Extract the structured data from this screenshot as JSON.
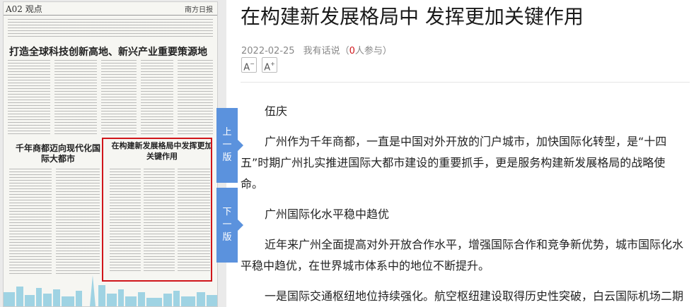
{
  "newspaper": {
    "page_number": "A02",
    "section": "观点",
    "masthead": "南方日报",
    "headline": "打造全球科技创新高地、新兴产业重要策源地",
    "sub_left": "千年商都迈向现代化国际大都市",
    "sub_right": "在构建新发展格局中发挥更加关键作用"
  },
  "nav": {
    "prev_label": "上一版",
    "next_label": "下一版"
  },
  "article": {
    "title": "在构建新发展格局中 发挥更加关键作用",
    "date": "2022-02-25",
    "comment_prefix": "我有话说（",
    "comment_count": "0",
    "comment_suffix": "人参与）",
    "font_decrease_label": "A",
    "font_increase_label": "A",
    "paragraphs": [
      "伍庆",
      "广州作为千年商都，一直是中国对外开放的门户城市，加快国际化转型，是“十四五”时期广州扎实推进国际大都市建设的重要抓手，更是服务构建新发展格局的战略使命。",
      "广州国际化水平稳中趋优",
      "近年来广州全面提高对外开放合作水平，增强国际合作和竞争新优势，城市国际化水平稳中趋优，在世界城市体系中的地位不断提升。",
      "一是国际交通枢纽地位持续强化。航空枢纽建设取得历史性突破，白云国际机场二期"
    ]
  },
  "colors": {
    "accent_blue": "#5b92dd",
    "highlight_red": "#d0161b",
    "meta_gray": "#888888"
  }
}
